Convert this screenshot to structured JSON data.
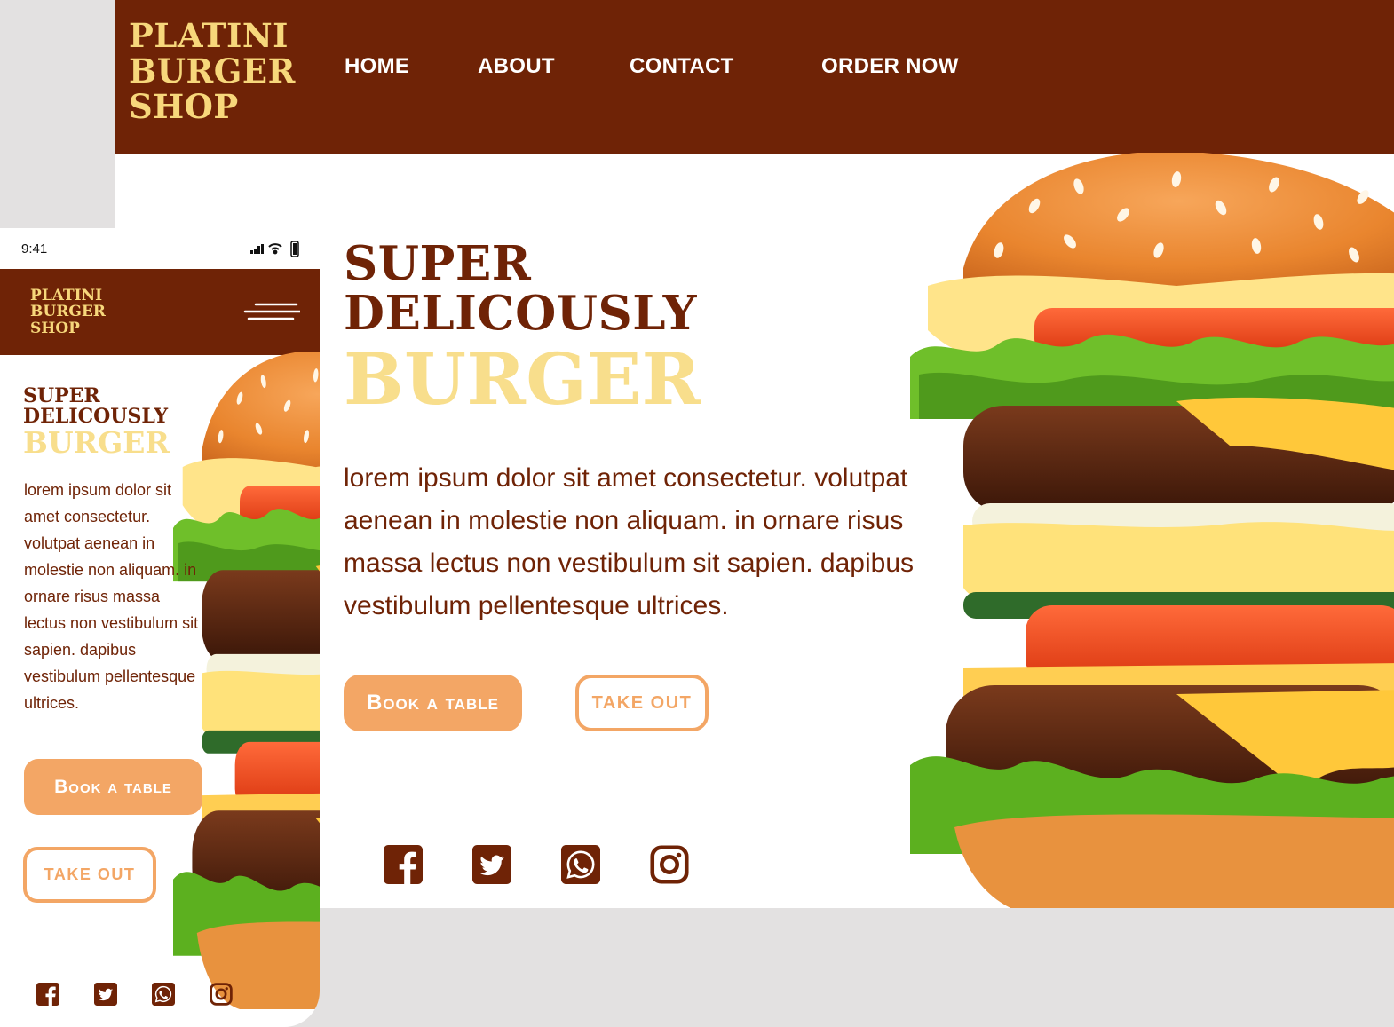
{
  "brand": {
    "lines": [
      "PLATINI",
      "BURGER",
      "SHOP"
    ]
  },
  "nav": [
    "HOME",
    "ABOUT",
    "CONTACT",
    "ORDER NOW"
  ],
  "hero": {
    "title_lines": [
      "SUPER",
      "DELICOUSLY"
    ],
    "title_accent": "BURGER",
    "description": "lorem ipsum dolor sit amet consectetur. volutpat aenean in molestie non aliquam. in ornare risus massa lectus non vestibulum sit sapien. dapibus vestibulum pellentesque ultrices.",
    "primary_button": "Book a table",
    "secondary_button": "TAKE OUT"
  },
  "mobile": {
    "status_time": "9:41"
  },
  "social_icons": [
    "facebook-icon",
    "twitter-icon",
    "whatsapp-icon",
    "instagram-icon"
  ],
  "colors": {
    "brand_brown": "#6f2306",
    "accent_yellow": "#f8de8c",
    "button_orange": "#f3a665",
    "background_gray": "#e3e1e1"
  }
}
